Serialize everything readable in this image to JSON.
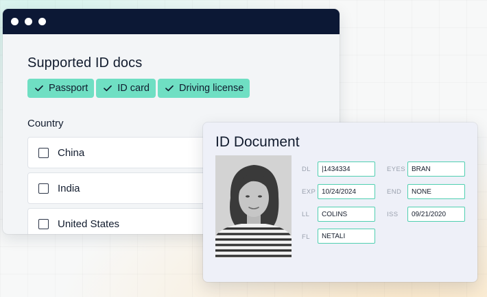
{
  "window": {
    "title": "Supported ID docs",
    "chips": [
      "Passport",
      "ID card",
      "Driving license"
    ],
    "country_label": "Country",
    "countries": [
      "China",
      "India",
      "United States"
    ]
  },
  "card": {
    "title": "ID Document",
    "fields": [
      {
        "label": "DL",
        "value": "|1434334"
      },
      {
        "label": "EYES",
        "value": "BRAN"
      },
      {
        "label": "EXP",
        "value": "10/24/2024"
      },
      {
        "label": "END",
        "value": "NONE"
      },
      {
        "label": "LL",
        "value": "COLINS"
      },
      {
        "label": "ISS",
        "value": "09/21/2020"
      },
      {
        "label": "FL",
        "value": "NETALI"
      }
    ]
  },
  "colors": {
    "titlebar": "#0c1835",
    "chip": "#6fdfc3",
    "field_border": "#4fcfb0"
  },
  "icons": {
    "chip": "check-icon",
    "photo": "portrait-photo"
  }
}
